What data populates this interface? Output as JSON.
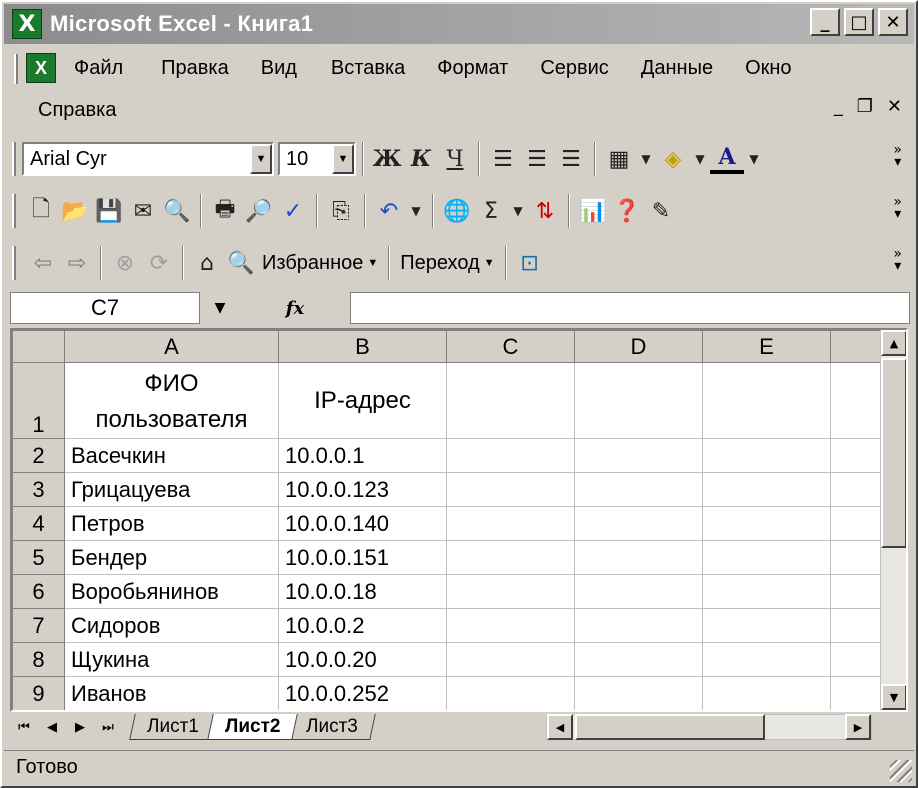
{
  "window": {
    "app_icon": "X",
    "title": "Microsoft Excel - Книга1",
    "minimize": "_",
    "maximize": "□",
    "close": "✕"
  },
  "menu": {
    "row1": [
      "Файл",
      "Правка",
      "Вид",
      "Вставка",
      "Формат",
      "Сервис",
      "Данные",
      "Окно"
    ],
    "row2": [
      "Справка"
    ],
    "mdi_minimize": "_",
    "mdi_restore": "❐",
    "mdi_close": "✕"
  },
  "format_toolbar": {
    "font_name": "Arial Cyr",
    "font_size": "10",
    "bold": "Ж",
    "italic": "К",
    "underline": "Ч"
  },
  "web_toolbar": {
    "favorites": "Избранное",
    "go": "Переход"
  },
  "formula_bar": {
    "name_box": "C7",
    "fx": "fx",
    "formula": ""
  },
  "sheet": {
    "columns": [
      "A",
      "B",
      "C",
      "D",
      "E"
    ],
    "header_row": {
      "row_num": "1",
      "a_line1": "ФИО",
      "a_line2": "пользователя",
      "b": "IP-адрес"
    },
    "rows": [
      {
        "num": "2",
        "a": "Васечкин",
        "b": "10.0.0.1"
      },
      {
        "num": "3",
        "a": "Грицацуева",
        "b": "10.0.0.123"
      },
      {
        "num": "4",
        "a": "Петров",
        "b": "10.0.0.140"
      },
      {
        "num": "5",
        "a": "Бендер",
        "b": "10.0.0.151"
      },
      {
        "num": "6",
        "a": "Воробьянинов",
        "b": "10.0.0.18"
      },
      {
        "num": "7",
        "a": "Сидоров",
        "b": "10.0.0.2"
      },
      {
        "num": "8",
        "a": "Щукина",
        "b": "10.0.0.20"
      },
      {
        "num": "9",
        "a": "Иванов",
        "b": "10.0.0.252"
      }
    ]
  },
  "tabs": [
    {
      "label": "Лист1",
      "active": false
    },
    {
      "label": "Лист2",
      "active": true
    },
    {
      "label": "Лист3",
      "active": false
    }
  ],
  "status": {
    "text": "Готово"
  },
  "icons": {
    "new": "new-file-icon",
    "open": "open-folder-icon",
    "save": "save-icon",
    "print": "print-icon",
    "preview": "print-preview-icon",
    "spell": "spell-check-icon",
    "copy": "copy-icon",
    "undo": "undo-icon",
    "sum": "autosum-icon",
    "sort": "sort-icon",
    "chart": "chart-wizard-icon",
    "help": "help-icon",
    "home": "home-icon",
    "search": "search-web-icon"
  }
}
